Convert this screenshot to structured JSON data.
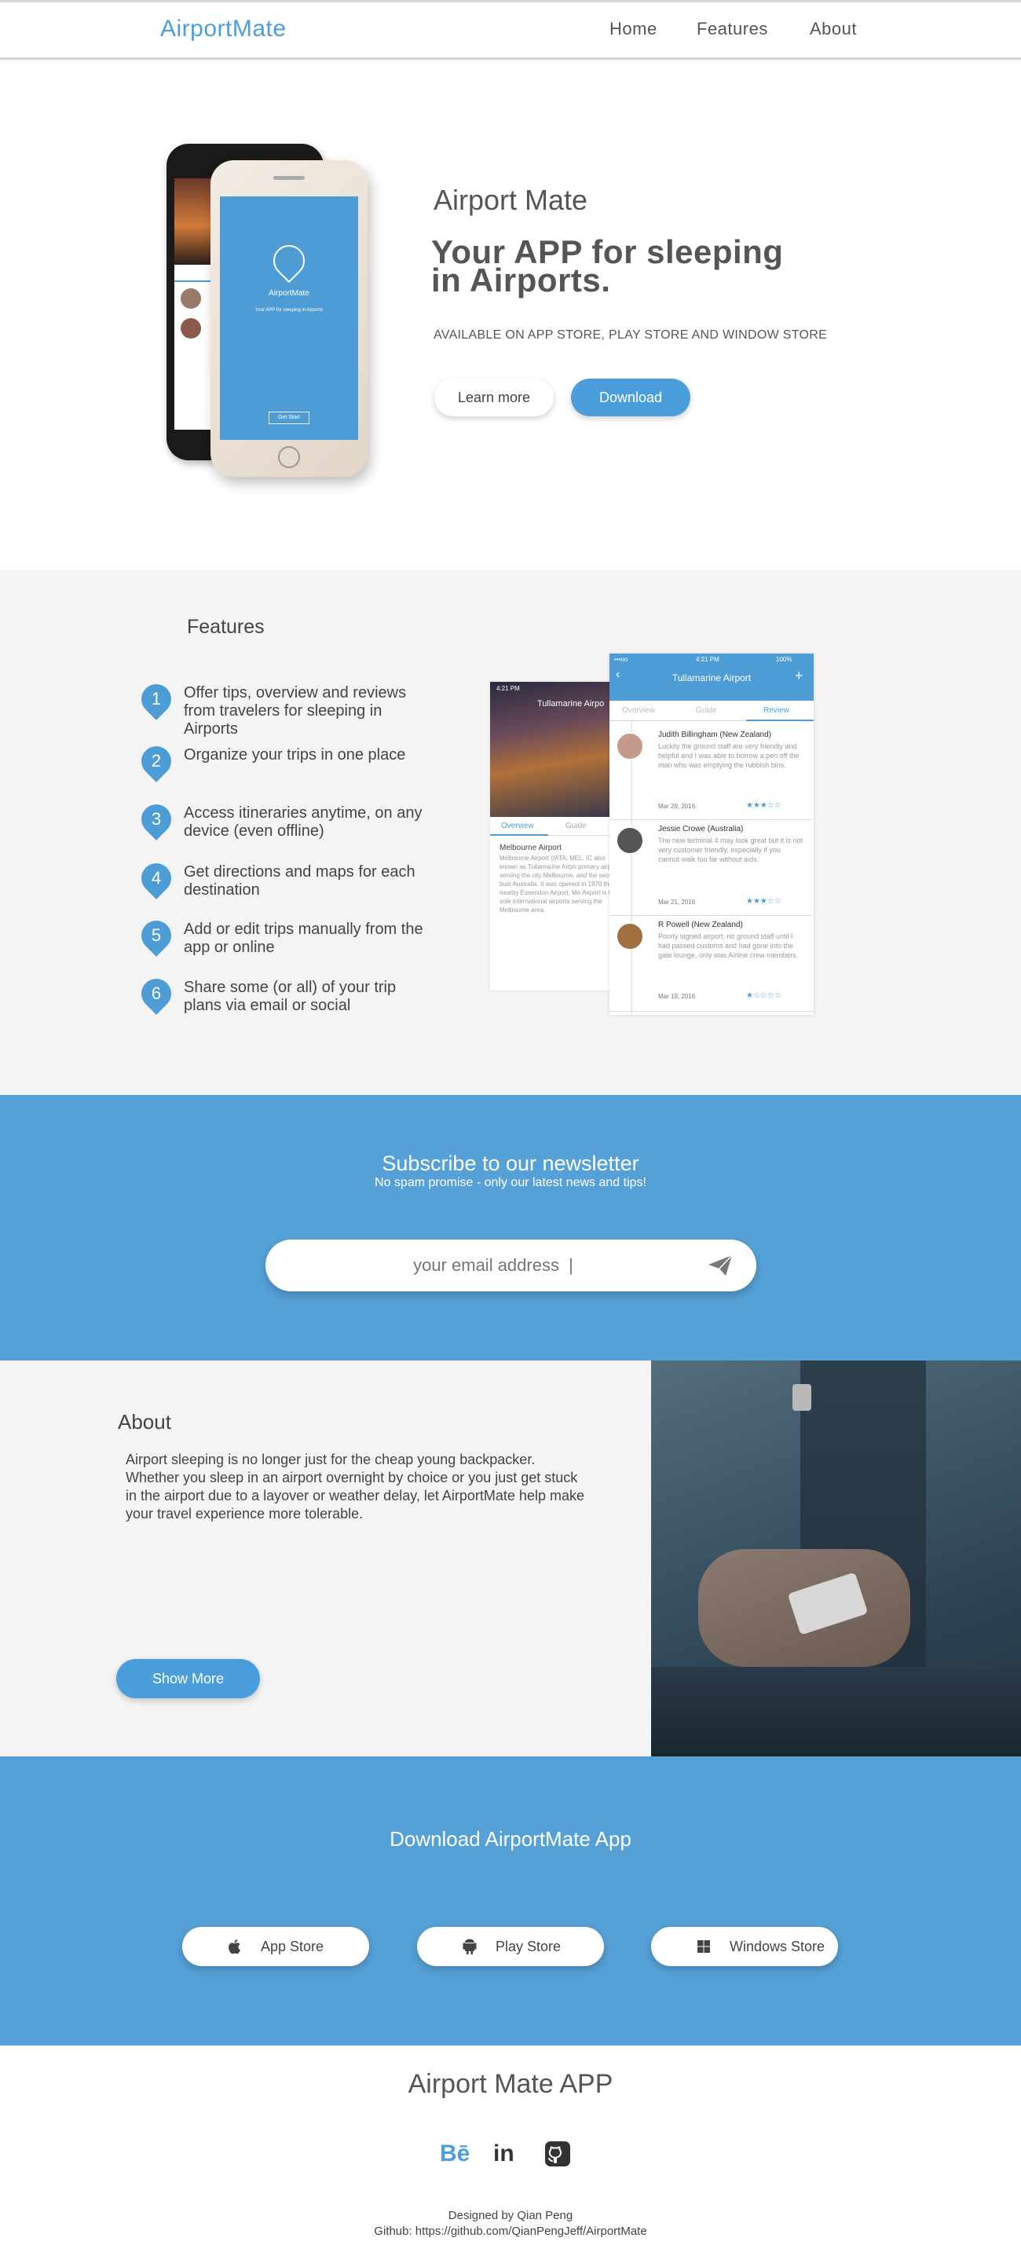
{
  "nav": {
    "brand": "AirportMate",
    "links": [
      "Home",
      "Features",
      "About"
    ]
  },
  "hero": {
    "title": "Airport Mate",
    "tagline_line1": "Your APP for sleeping",
    "tagline_line2": "in Airports.",
    "availability": "AVAILABLE ON APP STORE, PLAY STORE AND WINDOW STORE",
    "learn_more": "Learn more",
    "download": "Download",
    "phone_screen": {
      "app_name": "AirportMate",
      "subtitle": "Your APP for sleeping in Airports",
      "button": "Get Start"
    }
  },
  "features": {
    "title": "Features",
    "items": [
      {
        "num": "1",
        "text": "Offer tips, overview and reviews from travelers for sleeping in Airports"
      },
      {
        "num": "2",
        "text": "Organize your trips in one place"
      },
      {
        "num": "3",
        "text": "Access itineraries anytime, on any device (even offline)"
      },
      {
        "num": "4",
        "text": "Get directions and maps for each destination"
      },
      {
        "num": "5",
        "text": "Add or edit trips manually from the app or online"
      },
      {
        "num": "6",
        "text": "Share some (or all) of your trip plans via email or social"
      }
    ],
    "screen_left": {
      "time": "4:21 PM",
      "header": "Tullamarine Airpo",
      "tab_overview": "Overview",
      "tab_guide": "Guide",
      "heading": "Melbourne Airport",
      "body": "Melbourne Airport (IATA: MEL, IC also known as Tullamarine Airpo primary airport serving the city Melbourne, and the second busi Australia. It was opened in 1970 the nearby Essendon Airport, Me Airport is the sole international airports serving the Melbourne area."
    },
    "screen_right": {
      "status_left": "•••oo",
      "time": "4:21 PM",
      "battery": "100%",
      "header": "Tullamarine Airport",
      "tabs": [
        "Overview",
        "Guide",
        "Review"
      ],
      "reviews": [
        {
          "name": "Judith Billingham (New Zealand)",
          "text": "Luckily the ground staff are very friendly and helpful and I was able to borrow a pen off the man who was emptying the rubbish bins.",
          "date": "Mar 29, 2016",
          "stars": 3
        },
        {
          "name": "Jessie Crowe (Australia)",
          "text": "The new terminal 4 may look great but it is not very customer friendly, especially if you cannot walk too far without aids.",
          "date": "Mar 21, 2016",
          "stars": 3
        },
        {
          "name": "R Powell (New Zealand)",
          "text": "Poorly signed airport, no ground staff until I had passed customs and had gone into the gate lounge, only was Airline crew members.",
          "date": "Mar 19, 2016",
          "stars": 1
        }
      ]
    }
  },
  "newsletter": {
    "title": "Subscribe to our newsletter",
    "subtitle": "No spam promise - only our latest news and tips!",
    "placeholder": "your email address  |"
  },
  "about": {
    "title": "About",
    "text": "Airport sleeping is no longer just for the cheap young backpacker. Whether you sleep in an airport overnight by choice or you just get stuck in the airport due to a layover or weather delay, let AirportMate help make your travel experience more tolerable.",
    "button": "Show More"
  },
  "download": {
    "title": "Download AirportMate App",
    "stores": [
      {
        "label": "App Store",
        "icon": "apple-icon"
      },
      {
        "label": "Play Store",
        "icon": "android-icon"
      },
      {
        "label": "Windows Store",
        "icon": "windows-icon"
      }
    ]
  },
  "footer": {
    "title": "Airport Mate APP",
    "social": [
      "behance-icon",
      "linkedin-icon",
      "github-icon"
    ],
    "credit": "Designed by Qian Peng",
    "github": "Github:  https://github.com/QianPengJeff/AirportMate"
  },
  "colors": {
    "accent": "#4a9edb",
    "section_blue": "#55a0d6",
    "light_gray": "#f4f4f4",
    "text": "#444444"
  }
}
